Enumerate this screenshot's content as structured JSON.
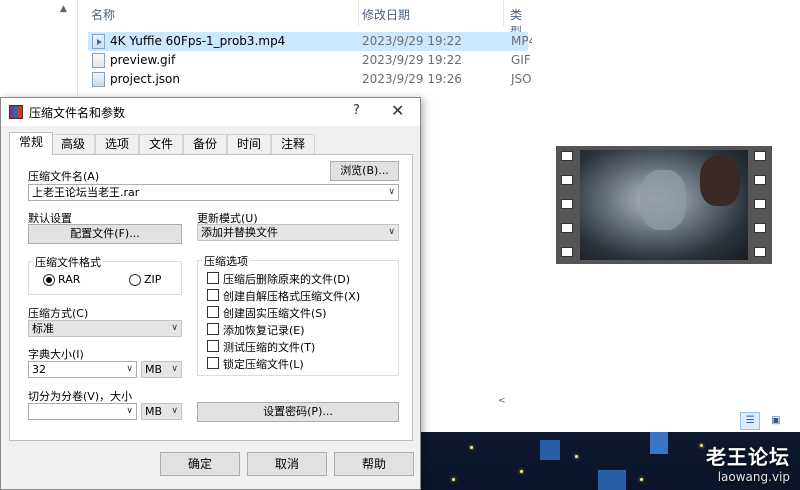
{
  "explorer": {
    "columns": {
      "name": "名称",
      "date": "修改日期",
      "type": "类型"
    },
    "files": [
      {
        "name": "4K Yuffie 60Fps-1_prob3.mp4",
        "date": "2023/9/29 19:22",
        "type": "MP4",
        "icon": "mp4-file-icon",
        "selected": true
      },
      {
        "name": "preview.gif",
        "date": "2023/9/29 19:22",
        "type": "GIF",
        "icon": "gif-file-icon",
        "selected": false
      },
      {
        "name": "project.json",
        "date": "2023/9/29 19:26",
        "type": "JSO",
        "icon": "json-file-icon",
        "selected": false
      }
    ],
    "selection_color": "#cce8ff"
  },
  "dialog": {
    "title": "压缩文件名和参数",
    "help_glyph": "?",
    "close_glyph": "✕",
    "tabs": [
      "常规",
      "高级",
      "选项",
      "文件",
      "备份",
      "时间",
      "注释"
    ],
    "active_tab": "常规",
    "archive_name_label": "压缩文件名(A)",
    "browse_button": "浏览(B)...",
    "archive_name_value": "上老王论坛当老王.rar",
    "default_settings_label": "默认设置",
    "profiles_button": "配置文件(F)...",
    "update_mode_label": "更新模式(U)",
    "update_mode_value": "添加并替换文件",
    "format_group_title": "压缩文件格式",
    "format_rar": "RAR",
    "format_zip": "ZIP",
    "selected_format": "RAR",
    "method_label": "压缩方式(C)",
    "method_value": "标准",
    "dict_label": "字典大小(I)",
    "dict_value": "32",
    "dict_unit": "MB",
    "split_label": "切分为分卷(V)，大小",
    "split_value": "",
    "split_unit": "MB",
    "options_group_title": "压缩选项",
    "options": [
      {
        "label": "压缩后删除原来的文件(D)",
        "checked": false
      },
      {
        "label": "创建自解压格式压缩文件(X)",
        "checked": false
      },
      {
        "label": "创建固实压缩文件(S)",
        "checked": false
      },
      {
        "label": "添加恢复记录(E)",
        "checked": false
      },
      {
        "label": "测试压缩的文件(T)",
        "checked": false
      },
      {
        "label": "锁定压缩文件(L)",
        "checked": false
      }
    ],
    "password_button": "设置密码(P)...",
    "ok_button": "确定",
    "cancel_button": "取消",
    "help_button": "帮助"
  },
  "watermark": {
    "title": "老王论坛",
    "url": "laowang.vip"
  },
  "colors": {
    "desktop_top": "#1e3a66",
    "desktop_bottom": "#0b1428",
    "dialog_bg": "#f0f0f0"
  }
}
